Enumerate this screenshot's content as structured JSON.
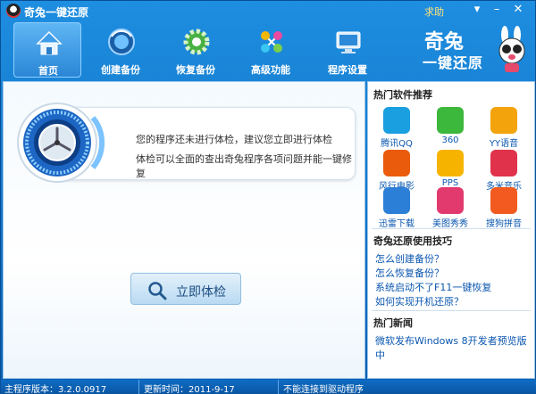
{
  "window": {
    "title": "奇兔一键还原",
    "help": "求助"
  },
  "toolbar": {
    "items": [
      {
        "label": "首页",
        "icon": "home-icon"
      },
      {
        "label": "创建备份",
        "icon": "backup-create-icon"
      },
      {
        "label": "恢复备份",
        "icon": "restore-gear-icon"
      },
      {
        "label": "高级功能",
        "icon": "advanced-molecule-icon"
      },
      {
        "label": "程序设置",
        "icon": "settings-monitor-icon"
      }
    ]
  },
  "brand": {
    "line1": "奇兔",
    "line2": "一键还原"
  },
  "main": {
    "message1": "您的程序还未进行体检，建议您立即进行体检",
    "message2": "体检可以全面的查出奇兔程序各项问题并能一键修复",
    "check_button": "立即体检"
  },
  "sidebar": {
    "hot_software_title": "热门软件推荐",
    "apps": [
      {
        "name": "腾讯QQ",
        "color": "#1a9fe0"
      },
      {
        "name": "360",
        "color": "#3cb83c"
      },
      {
        "name": "YY语音",
        "color": "#f3a30b"
      },
      {
        "name": "风行电影",
        "color": "#ea5b0c"
      },
      {
        "name": "PPS",
        "color": "#f6b400"
      },
      {
        "name": "多米音乐",
        "color": "#e0324b"
      },
      {
        "name": "迅雷下载",
        "color": "#2b7fd6"
      },
      {
        "name": "美图秀秀",
        "color": "#e23a6f"
      },
      {
        "name": "搜狗拼音",
        "color": "#f25a1f"
      }
    ],
    "tips_title": "奇兔还原使用技巧",
    "tips": [
      "怎么创建备份？",
      "怎么恢复备份？",
      "系统启动不了F11一键恢复",
      "如何实现开机还原？"
    ],
    "news_title": "热门新闻",
    "news": [
      "微软发布Windows 8开发者预览版",
      "中"
    ]
  },
  "status": {
    "version": "主程序版本：3.2.0.0917",
    "update": "更新时间：2011-9-17",
    "driver": "不能连接到驱动程序"
  }
}
